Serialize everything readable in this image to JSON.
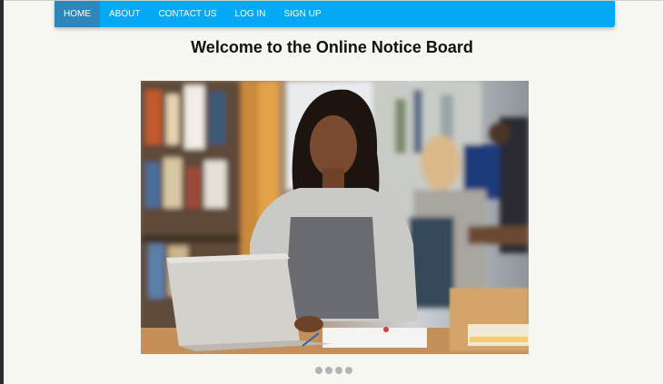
{
  "navbar": {
    "items": [
      {
        "label": "HOME",
        "active": true
      },
      {
        "label": "ABOUT",
        "active": false
      },
      {
        "label": "CONTACT US",
        "active": false
      },
      {
        "label": "LOG IN",
        "active": false
      },
      {
        "label": "SIGN UP",
        "active": false
      }
    ],
    "color": "#03a9f4",
    "active_color": "#2f86bb"
  },
  "page": {
    "title": "Welcome to the Online Notice Board"
  },
  "carousel": {
    "slide_count": 4,
    "active_slide": 1,
    "hero_alt": "student-with-laptop-in-library-photo"
  }
}
